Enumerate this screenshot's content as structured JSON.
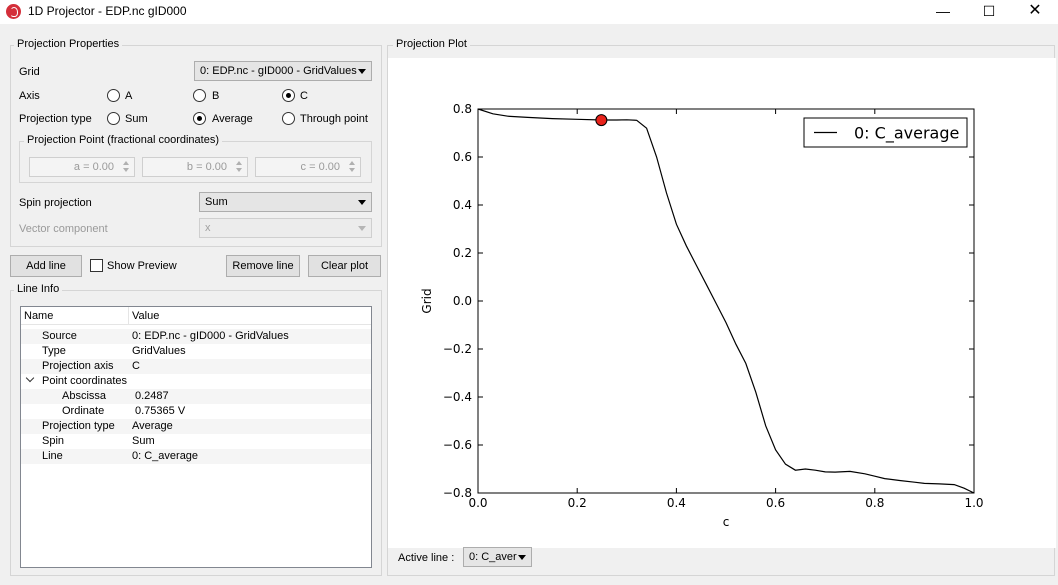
{
  "window": {
    "title": "1D Projector - EDP.nc gID000",
    "minimize": "—",
    "maximize": "☐",
    "close": "✕"
  },
  "properties": {
    "group_title": "Projection Properties",
    "grid_label": "Grid",
    "grid_value": "0: EDP.nc - gID000 - GridValues",
    "axis_label": "Axis",
    "axis_options": [
      "A",
      "B",
      "C"
    ],
    "axis_selected": "C",
    "ptype_label": "Projection type",
    "ptype_options": [
      "Sum",
      "Average",
      "Through point"
    ],
    "ptype_selected": "Average",
    "point_group_title": "Projection Point (fractional coordinates)",
    "point_a": "a = 0.00",
    "point_b": "b = 0.00",
    "point_c": "c = 0.00",
    "spin_label": "Spin projection",
    "spin_value": "Sum",
    "vector_label": "Vector component",
    "vector_value": "x"
  },
  "actions": {
    "add_line": "Add line",
    "show_preview": "Show Preview",
    "remove_line": "Remove line",
    "clear_plot": "Clear plot"
  },
  "line_info": {
    "group_title": "Line Info",
    "col_name": "Name",
    "col_value": "Value",
    "rows": [
      {
        "name": "Source",
        "value": "0: EDP.nc - gID000 - GridValues"
      },
      {
        "name": "Type",
        "value": "GridValues"
      },
      {
        "name": "Projection axis",
        "value": "C"
      },
      {
        "name": "Point coordinates",
        "value": ""
      },
      {
        "name": "Abscissa",
        "value": "0.2487"
      },
      {
        "name": "Ordinate",
        "value": "0.75365 V"
      },
      {
        "name": "Projection type",
        "value": "Average"
      },
      {
        "name": "Spin",
        "value": "Sum"
      },
      {
        "name": "Line",
        "value": "0: C_average"
      }
    ]
  },
  "plot": {
    "group_title": "Projection Plot",
    "active_line_label": "Active line :",
    "active_line_value": "0: C_aver"
  },
  "chart_data": {
    "type": "line",
    "xlabel": "c",
    "ylabel": "Grid",
    "xlim": [
      0.0,
      1.0
    ],
    "ylim": [
      -0.8,
      0.8
    ],
    "xticks": [
      "0.0",
      "0.2",
      "0.4",
      "0.6",
      "0.8",
      "1.0"
    ],
    "yticks": [
      "0.8",
      "0.6",
      "0.4",
      "0.2",
      "0.0",
      "−0.2",
      "−0.4",
      "−0.6",
      "−0.8"
    ],
    "legend_placement": "top-right",
    "series": [
      {
        "name": "0: C_average",
        "color": "#000000",
        "x": [
          0.0,
          0.03,
          0.06,
          0.1,
          0.15,
          0.2,
          0.25,
          0.28,
          0.3,
          0.32,
          0.34,
          0.36,
          0.38,
          0.4,
          0.42,
          0.44,
          0.46,
          0.48,
          0.5,
          0.52,
          0.54,
          0.56,
          0.58,
          0.6,
          0.62,
          0.64,
          0.66,
          0.68,
          0.7,
          0.72,
          0.75,
          0.78,
          0.8,
          0.82,
          0.85,
          0.88,
          0.9,
          0.93,
          0.96,
          0.98,
          1.0
        ],
        "y": [
          0.8,
          0.78,
          0.77,
          0.765,
          0.76,
          0.757,
          0.754,
          0.754,
          0.755,
          0.753,
          0.72,
          0.6,
          0.45,
          0.32,
          0.23,
          0.15,
          0.07,
          -0.01,
          -0.09,
          -0.18,
          -0.26,
          -0.38,
          -0.52,
          -0.62,
          -0.68,
          -0.705,
          -0.7,
          -0.705,
          -0.712,
          -0.713,
          -0.71,
          -0.72,
          -0.73,
          -0.74,
          -0.748,
          -0.755,
          -0.76,
          -0.762,
          -0.765,
          -0.78,
          -0.8
        ]
      }
    ],
    "marker": {
      "x": 0.2487,
      "y": 0.75365,
      "color": "#e8231b"
    }
  }
}
